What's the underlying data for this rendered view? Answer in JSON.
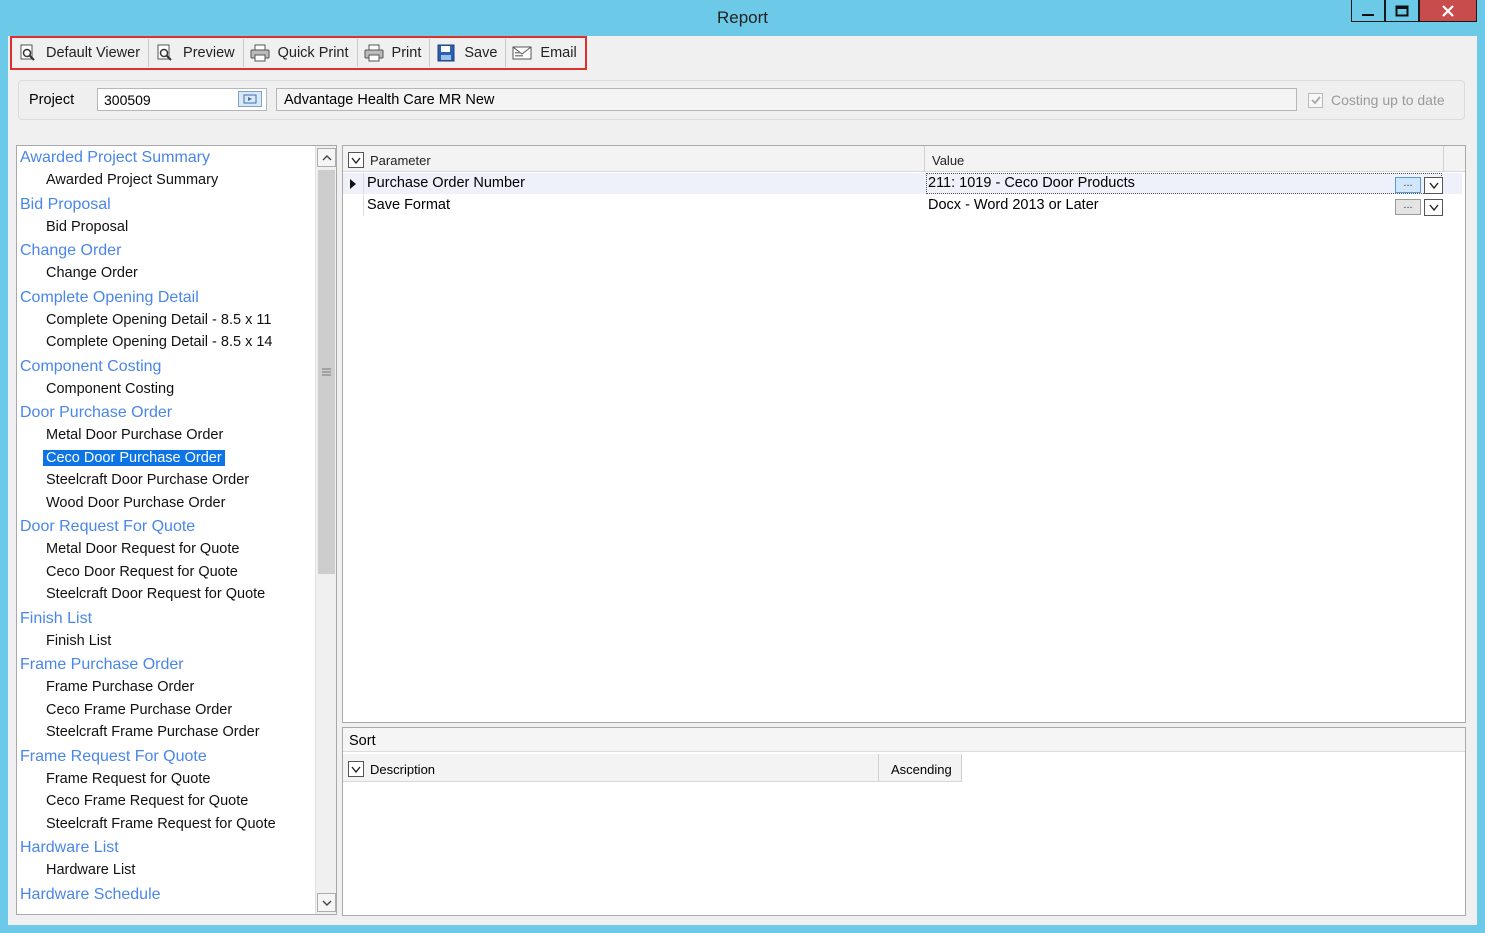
{
  "window": {
    "title": "Report"
  },
  "toolbar": {
    "buttons": [
      {
        "label": "Default Viewer",
        "icon": "magnifier-page-icon"
      },
      {
        "label": "Preview",
        "icon": "preview-icon"
      },
      {
        "label": "Quick Print",
        "icon": "printer-icon"
      },
      {
        "label": "Print",
        "icon": "printer-icon"
      },
      {
        "label": "Save",
        "icon": "floppy-disk-icon"
      },
      {
        "label": "Email",
        "icon": "envelope-icon"
      }
    ]
  },
  "project": {
    "label": "Project",
    "number": "300509",
    "description": "Advantage Health Care MR New",
    "costing_label": "Costing up to date",
    "costing_checked": true
  },
  "report_tree": {
    "groups": [
      {
        "name": "Awarded Project Summary",
        "items": [
          "Awarded Project Summary"
        ]
      },
      {
        "name": "Bid Proposal",
        "items": [
          "Bid Proposal"
        ]
      },
      {
        "name": "Change Order",
        "items": [
          "Change Order"
        ]
      },
      {
        "name": "Complete Opening Detail",
        "items": [
          "Complete Opening Detail - 8.5 x 11",
          "Complete Opening Detail - 8.5 x 14"
        ]
      },
      {
        "name": "Component Costing",
        "items": [
          "Component Costing"
        ]
      },
      {
        "name": "Door Purchase Order",
        "items": [
          "Metal Door Purchase Order",
          "Ceco Door Purchase Order",
          "Steelcraft Door Purchase Order",
          "Wood Door Purchase Order"
        ]
      },
      {
        "name": "Door Request For Quote",
        "items": [
          "Metal Door Request for Quote",
          "Ceco Door Request for Quote",
          "Steelcraft Door Request for Quote"
        ]
      },
      {
        "name": "Finish List",
        "items": [
          "Finish List"
        ]
      },
      {
        "name": "Frame Purchase Order",
        "items": [
          "Frame Purchase Order",
          "Ceco Frame Purchase Order",
          "Steelcraft Frame Purchase Order"
        ]
      },
      {
        "name": "Frame Request For Quote",
        "items": [
          "Frame Request for Quote",
          "Ceco Frame Request for Quote",
          "Steelcraft Frame Request for Quote"
        ]
      },
      {
        "name": "Hardware List",
        "items": [
          "Hardware List"
        ]
      },
      {
        "name": "Hardware Schedule",
        "items": []
      }
    ],
    "selected": "Ceco Door Purchase Order"
  },
  "parameters": {
    "columns": {
      "parameter": "Parameter",
      "value": "Value"
    },
    "rows": [
      {
        "parameter": "Purchase Order Number",
        "value": "211: 1019 - Ceco Door Products"
      },
      {
        "parameter": "Save Format",
        "value": "Docx - Word 2013 or Later"
      }
    ],
    "ellipsis": "..."
  },
  "sort": {
    "title": "Sort",
    "columns": {
      "description": "Description",
      "direction": "Ascending"
    }
  },
  "colors": {
    "window_frame": "#6ccae8",
    "group_link": "#4a86e8",
    "selection": "#0c74e4",
    "toolbar_highlight": "#e0302c",
    "close_button": "#c94c4c"
  }
}
